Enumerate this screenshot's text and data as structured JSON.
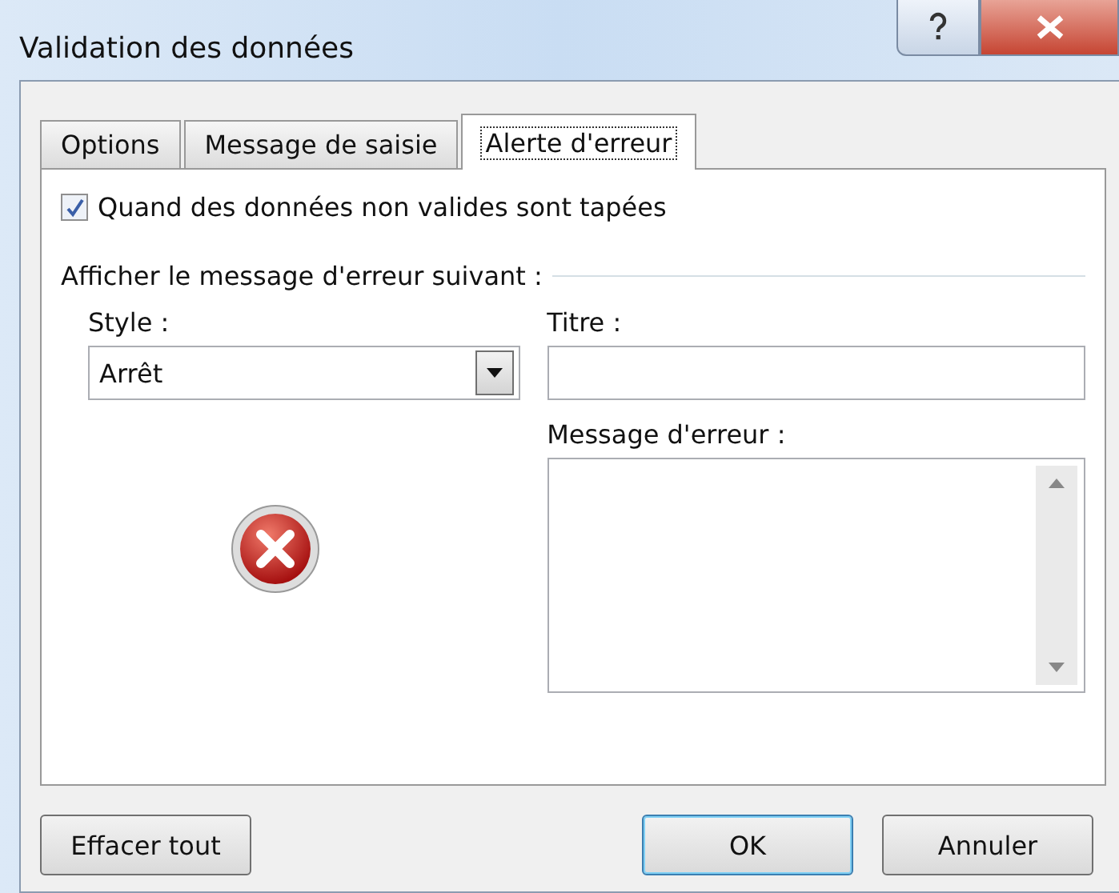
{
  "window": {
    "title": "Validation des données"
  },
  "tabs": [
    {
      "label": "Options",
      "selected": false
    },
    {
      "label": "Message de saisie",
      "selected": false
    },
    {
      "label": "Alerte d'erreur",
      "selected": true
    }
  ],
  "show_alert": {
    "label": "Quand des données non valides sont tapées",
    "checked": true
  },
  "section_title": "Afficher le message d'erreur suivant :",
  "style": {
    "label": "Style :",
    "value": "Arrêt"
  },
  "title_field": {
    "label": "Titre :"
  },
  "message_field": {
    "label": "Message d'erreur :"
  },
  "buttons": [
    {
      "label": "Effacer tout",
      "kind": "secondary"
    },
    {
      "label": "OK",
      "kind": "default"
    },
    {
      "label": "Annuler",
      "kind": "secondary"
    }
  ]
}
